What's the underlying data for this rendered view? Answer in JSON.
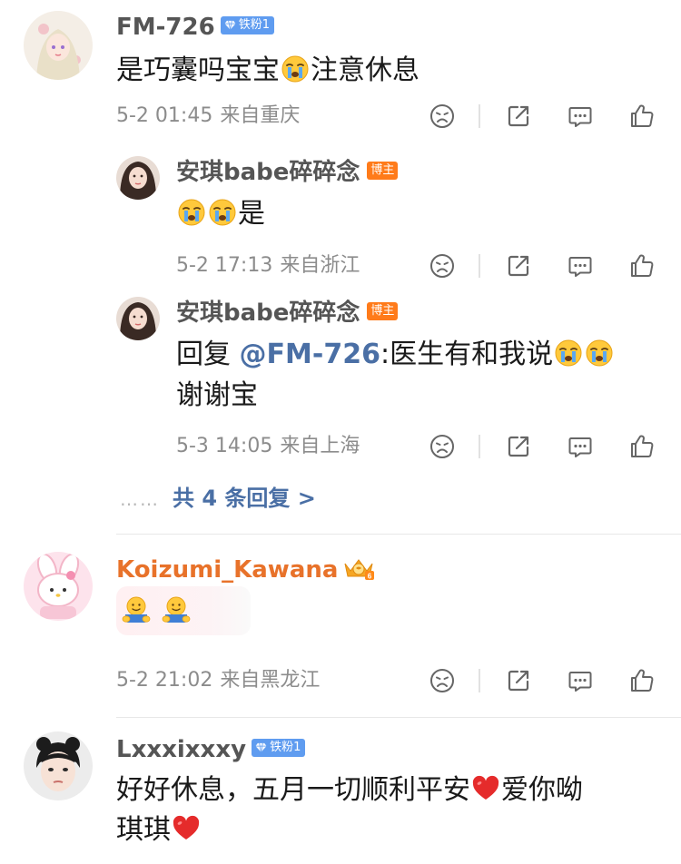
{
  "comments": [
    {
      "username": "FM-726",
      "fan_badge": "铁粉1",
      "text": "是巧囊吗宝宝",
      "text2": "注意休息",
      "date": "5-2 01:45",
      "location": "来自重庆",
      "replies": [
        {
          "username": "安琪babe碎碎念",
          "host_badge": "博主",
          "text": "是",
          "date": "5-2 17:13",
          "location": "来自浙江"
        },
        {
          "username": "安琪babe碎碎念",
          "host_badge": "博主",
          "reply_prefix": "回复 ",
          "mention": "@FM-726",
          "text": ":医生有和我说",
          "text_line2": "谢谢宝",
          "date": "5-3 14:05",
          "location": "来自上海"
        }
      ],
      "more_dots": "……",
      "more_label": "共 4 条回复 >"
    },
    {
      "username": "Koizumi_Kawana",
      "date": "5-2 21:02",
      "location": "来自黑龙江"
    },
    {
      "username": "Lxxxixxxy",
      "fan_badge": "铁粉1",
      "text": "好好休息，五月一切顺利平安",
      "text2": "爱你呦",
      "text_line2": "琪琪"
    }
  ],
  "icons": [
    "unlike-icon",
    "share-icon",
    "comment-icon",
    "like-icon",
    "crown-icon",
    "diamond-icon",
    "crying-emoji",
    "hug-emoji",
    "heart-emoji"
  ],
  "colors": {
    "link": "#4a6fa5",
    "orange_name": "#e8722a",
    "fan_badge": "#5f9cf0",
    "host_badge": "#ff7b1a",
    "meta": "#8c8c8c"
  }
}
